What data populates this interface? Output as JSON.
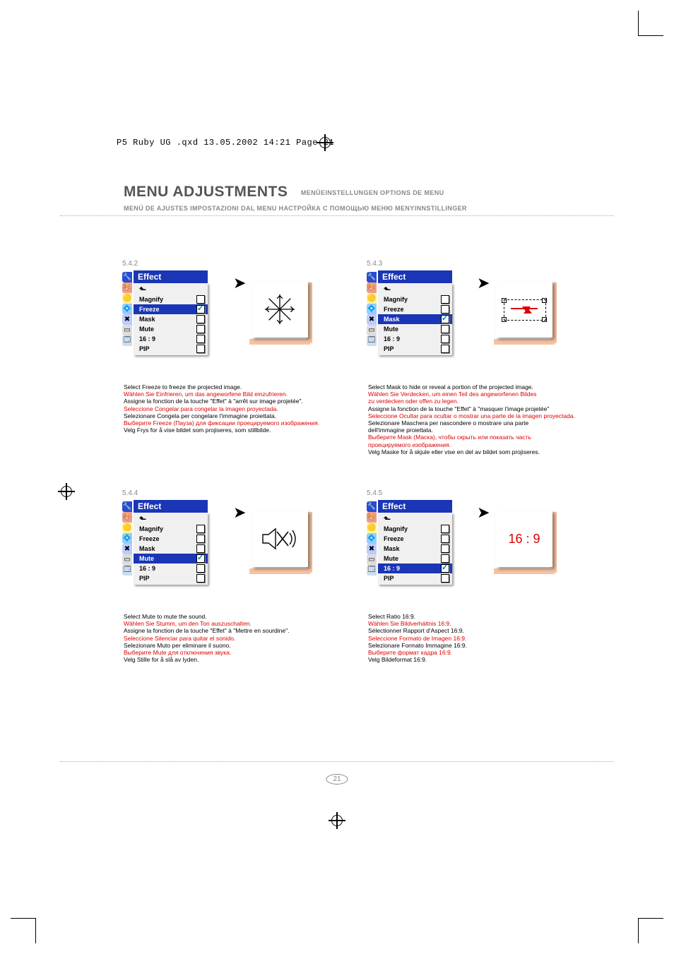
{
  "slug": "P5 Ruby UG .qxd  13.05.2002  14:21  Page 21",
  "title": "MENU ADJUSTMENTS",
  "subtitles1": "MENÜEINSTELLUNGEN   OPTIONS DE MENU",
  "subtitles2": "MENÚ DE AJUSTES   IMPOSTAZIONI DAL MENU   НАСТРОЙКА С ПОМОЩЬЮ МЕНЮ   MENYINNSTILLINGER",
  "page_number": "21",
  "menu_title": "Effect",
  "back_glyph": "⬑",
  "items": {
    "magnify": "Magnify",
    "freeze": "Freeze",
    "mask": "Mask",
    "mute": "Mute",
    "ratio": "16 : 9",
    "pip": "PIP"
  },
  "ratio_display": "16 : 9",
  "blocks": {
    "b542": {
      "num": "5.4.2",
      "desc": [
        {
          "t": "Select Freeze to freeze the projected image.",
          "c": "k"
        },
        {
          "t": "Wählen Sie Einfrieren, um das angeworfene Bild einzufrieren.",
          "c": "r"
        },
        {
          "t": "Assigne la fonction de la touche \"Effet\" à \"arrêt sur image projetée\".",
          "c": "k"
        },
        {
          "t": "Seleccione Congelar para congelar la imagen proyectada.",
          "c": "r"
        },
        {
          "t": "Selezionare Congela per congelare l'immagine proiettata.",
          "c": "k"
        },
        {
          "t": "Выберите Freeze (Пауза) для фиксации проецируемого изображения.",
          "c": "r"
        },
        {
          "t": "Velg Frys for å vise bildet som projiseres, som stillbilde.",
          "c": "k"
        }
      ]
    },
    "b543": {
      "num": "5.4.3",
      "desc": [
        {
          "t": "Select Mask to hide or reveal a portion of the projected image.",
          "c": "k"
        },
        {
          "t": "Wählen Sie Verdecken, um einen Teil des angeworfenen Bildes",
          "c": "r"
        },
        {
          "t": "zu verdecken oder offen zu legen.",
          "c": "r"
        },
        {
          "t": "Assigne la fonction de la touche \"Effet\" à \"masquer l'image projetée\"",
          "c": "k"
        },
        {
          "t": "Seleccione Ocultar para ocultar o mostrar una parte de la imagen proyectada.",
          "c": "r"
        },
        {
          "t": "Selezionare Maschera per nascondere o mostrare una parte",
          "c": "k"
        },
        {
          "t": "dell'immagine proiettata.",
          "c": "k"
        },
        {
          "t": "Выберите Mask (Маска), чтобы скрыть или показать часть",
          "c": "r"
        },
        {
          "t": "проецируемого изображения.",
          "c": "r"
        },
        {
          "t": "Velg Maske for å skjule eller vise en del av bildet som projiseres.",
          "c": "k"
        }
      ]
    },
    "b544": {
      "num": "5.4.4",
      "desc": [
        {
          "t": "Select Mute to mute the sound.",
          "c": "k"
        },
        {
          "t": "Wählen Sie Stumm, um den Ton auszuschalten.",
          "c": "r"
        },
        {
          "t": "Assigne la fonction de la touche \"Effet\" à \"Mettre en sourdine\".",
          "c": "k"
        },
        {
          "t": "Seleccione Silenciar para quitar el sonido.",
          "c": "r"
        },
        {
          "t": "Selezionare Muto per eliminare il suono.",
          "c": "k"
        },
        {
          "t": "Выберите Mute для отключения звука.",
          "c": "r"
        },
        {
          "t": "Velg Stille for å slå av lyden.",
          "c": "k"
        }
      ]
    },
    "b545": {
      "num": "5.4.5",
      "desc": [
        {
          "t": "Select Ratio 16:9.",
          "c": "k"
        },
        {
          "t": "Wählen Sie Bildverhältnis 16:9.",
          "c": "r"
        },
        {
          "t": "Sélectionner Rapport d'Aspect 16:9.",
          "c": "k"
        },
        {
          "t": "Seleccione Formato de Imagen 16:9.",
          "c": "r"
        },
        {
          "t": "Selezionare Formato Immagine 16:9.",
          "c": "k"
        },
        {
          "t": "Выберите формат кадра 16:9.",
          "c": "r"
        },
        {
          "t": "Velg Bildeformat 16:9.",
          "c": "k"
        }
      ]
    }
  }
}
